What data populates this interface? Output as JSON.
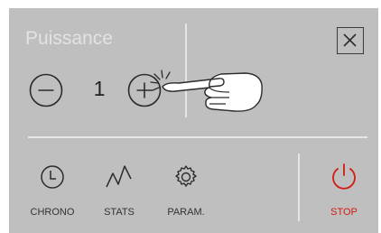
{
  "power": {
    "title": "Puissance",
    "value": "1",
    "decrement_icon": "minus-circle-icon",
    "increment_icon": "plus-circle-icon"
  },
  "close": {
    "icon": "close-icon"
  },
  "footer": {
    "chrono": {
      "label": "CHRONO",
      "icon": "clock-icon"
    },
    "stats": {
      "label": "STATS",
      "icon": "chart-line-icon"
    },
    "param": {
      "label": "PARAM.",
      "icon": "gear-icon"
    },
    "stop": {
      "label": "STOP",
      "icon": "power-icon",
      "color": "#d31b12"
    }
  },
  "overlay": {
    "icon": "pointing-hand-icon"
  },
  "colors": {
    "panel": "#bfbfbf",
    "divider": "#e6e6e6",
    "accent": "#d31b12"
  }
}
